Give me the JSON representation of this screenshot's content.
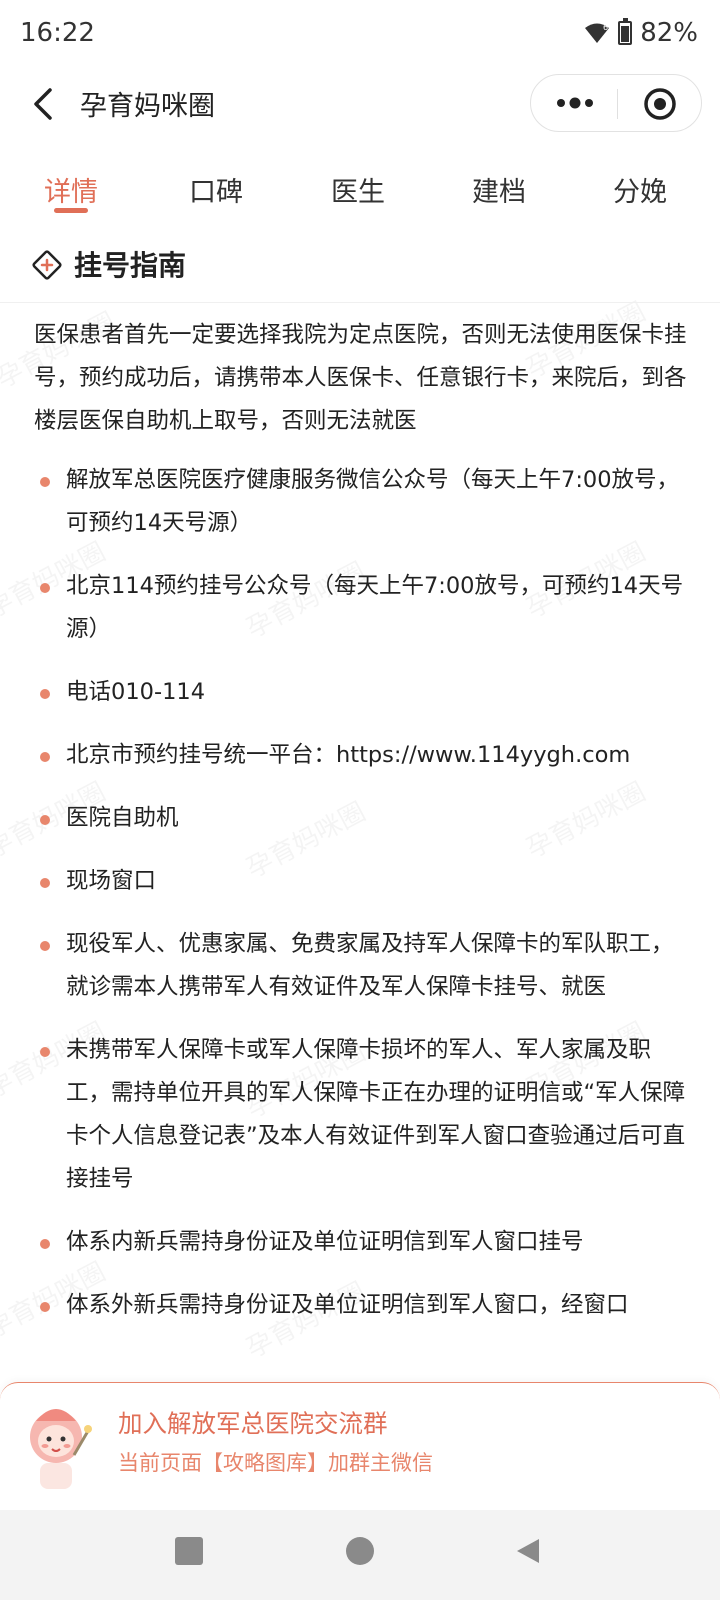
{
  "status_bar": {
    "time": "16:22",
    "battery": "82%"
  },
  "nav": {
    "title": "孕育妈咪圈"
  },
  "tabs": [
    {
      "label": "详情",
      "active": true
    },
    {
      "label": "口碑",
      "active": false
    },
    {
      "label": "医生",
      "active": false
    },
    {
      "label": "建档",
      "active": false
    },
    {
      "label": "分娩",
      "active": false
    }
  ],
  "section": {
    "title": "挂号指南"
  },
  "intro": "医保患者首先一定要选择我院为定点医院，否则无法使用医保卡挂号，预约成功后，请携带本人医保卡、任意银行卡，来院后，到各楼层医保自助机上取号，否则无法就医",
  "items": [
    "解放军总医院医疗健康服务微信公众号（每天上午7:00放号，可预约14天号源）",
    "北京114预约挂号公众号（每天上午7:00放号，可预约14天号源）",
    "电话010-114",
    "北京市预约挂号统一平台：https://www.114yygh.com",
    "医院自助机",
    "现场窗口",
    "现役军人、优惠家属、免费家属及持军人保障卡的军队职工，就诊需本人携带军人有效证件及军人保障卡挂号、就医",
    "未携带军人保障卡或军人保障卡损坏的军人、军人家属及职工，需持单位开具的军人保障卡正在办理的证明信或“军人保障卡个人信息登记表”及本人有效证件到军人窗口查验通过后可直接挂号",
    "体系内新兵需持身份证及单位证明信到军人窗口挂号",
    "体系外新兵需持身份证及单位证明信到军人窗口，经窗口"
  ],
  "promo": {
    "title": "加入解放军总医院交流群",
    "subtitle": "当前页面【攻略图库】加群主微信"
  },
  "watermark": "孕育妈咪圈",
  "colors": {
    "accent": "#e06f57",
    "bullet": "#e8866c"
  }
}
